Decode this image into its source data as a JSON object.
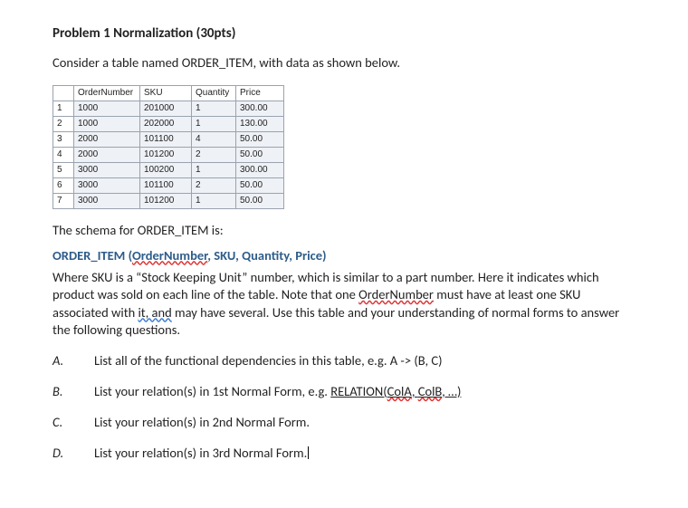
{
  "title": "Problem 1 Normalization (30pts)",
  "intro": "Consider a table named ORDER_ITEM, with data as shown below.",
  "table": {
    "headers": [
      "OrderNumber",
      "SKU",
      "Quantity",
      "Price"
    ],
    "rows": [
      {
        "n": "1",
        "OrderNumber": "1000",
        "SKU": "201000",
        "Quantity": "1",
        "Price": "300.00"
      },
      {
        "n": "2",
        "OrderNumber": "1000",
        "SKU": "202000",
        "Quantity": "1",
        "Price": "130.00"
      },
      {
        "n": "3",
        "OrderNumber": "2000",
        "SKU": "101100",
        "Quantity": "4",
        "Price": "50.00"
      },
      {
        "n": "4",
        "OrderNumber": "2000",
        "SKU": "101200",
        "Quantity": "2",
        "Price": "50.00"
      },
      {
        "n": "5",
        "OrderNumber": "3000",
        "SKU": "100200",
        "Quantity": "1",
        "Price": "300.00"
      },
      {
        "n": "6",
        "OrderNumber": "3000",
        "SKU": "101100",
        "Quantity": "2",
        "Price": "50.00"
      },
      {
        "n": "7",
        "OrderNumber": "3000",
        "SKU": "101200",
        "Quantity": "1",
        "Price": "50.00"
      }
    ]
  },
  "schema_label": "The schema for ORDER_ITEM is:",
  "schema_line": {
    "prefix": "ORDER_ITEM (",
    "pk": "OrderNumber",
    "rest": ", SKU, Quantity, Price)"
  },
  "body": {
    "p1a": "Where SKU is a “Stock Keeping Unit” number, which is similar to a part number. Here it indicates which product was sold on each line of the table. Note that one ",
    "p1_order": "OrderNumber",
    "p1b": " must have at least one SKU associated with ",
    "p1_itand": "it, and",
    "p1c": " may have several. Use this table and your understanding of normal forms to answer the following questions."
  },
  "questions": [
    {
      "label": "A.",
      "pre": "List all of the functional dependencies in this table, e.g. A -> (B, C)",
      "relation": "",
      "cola": "",
      "colb": "",
      "post": ""
    },
    {
      "label": "B.",
      "pre": "List your relation(s) in 1st Normal Form, e.g.  ",
      "relation": "RELATION(",
      "cola": "ColA",
      "mid": ", ",
      "colb": "ColB",
      "post": ", …)"
    },
    {
      "label": "C.",
      "pre": "List your relation(s) in 2nd Normal Form.",
      "relation": "",
      "cola": "",
      "colb": "",
      "post": ""
    },
    {
      "label": "D.",
      "pre": "List your relation(s) in 3rd Normal Form.",
      "relation": "",
      "cola": "",
      "colb": "",
      "post": ""
    }
  ]
}
